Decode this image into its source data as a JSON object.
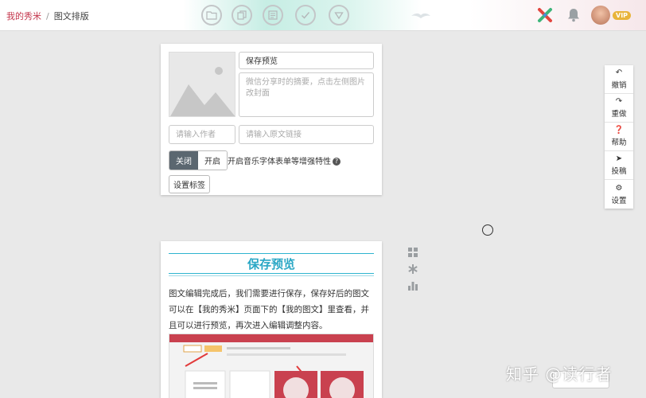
{
  "breadcrumb": {
    "home": "我的秀米",
    "separator": "/",
    "current": "图文排版"
  },
  "toolbar": {
    "icons": [
      "folder-icon",
      "copy-icon",
      "preview-icon",
      "save-check-icon",
      "download-icon"
    ]
  },
  "user": {
    "vip_badge": "VIP"
  },
  "editor": {
    "title_value": "保存预览",
    "summary_placeholder": "微信分享时的摘要，点击左侧图片改封面",
    "author_placeholder": "请输入作者",
    "source_link_placeholder": "请输入原文链接",
    "toggle": {
      "off_label": "关闭",
      "on_label": "开启",
      "selected": "关闭"
    },
    "feature_text": "开启音乐字体表单等增强特性",
    "set_tags_label": "设置标签"
  },
  "article": {
    "section_title": "保存预览",
    "body_text": "图文编辑完成后，我们需要进行保存，保存好后的图文可以在【我的秀米】页面下的【我的图文】里查看，并且可以进行预览，再次进入编辑调整内容。"
  },
  "right_toolbar": [
    {
      "label": "撤销",
      "icon": "undo-icon"
    },
    {
      "label": "重做",
      "icon": "redo-icon"
    },
    {
      "label": "帮助",
      "icon": "help-icon"
    },
    {
      "label": "投稿",
      "icon": "submit-icon"
    },
    {
      "label": "设置",
      "icon": "gear-icon"
    }
  ],
  "side_tools": [
    "grid-icon",
    "snowflake-icon",
    "bar-chart-icon"
  ],
  "watermark": "知乎 @读行者",
  "colors": {
    "brand": "#c4364c",
    "accent": "#2aa7c5",
    "toggle_active": "#5b6770"
  }
}
